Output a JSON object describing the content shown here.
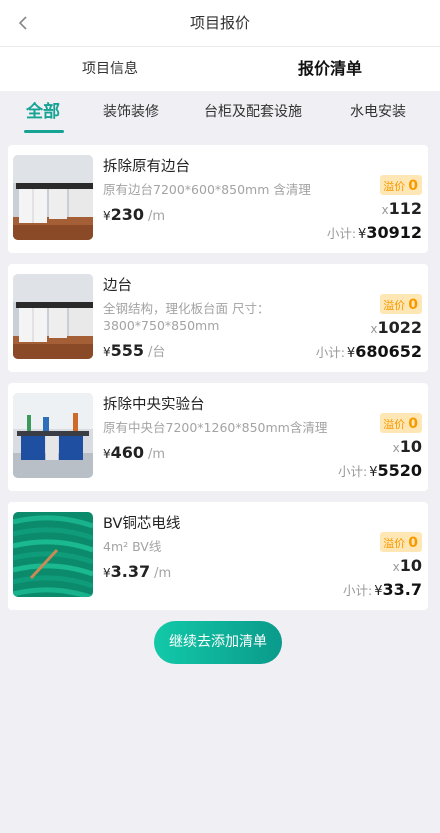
{
  "header": {
    "title": "项目报价"
  },
  "top_tabs": [
    {
      "label": "项目信息"
    },
    {
      "label": "报价清单"
    }
  ],
  "categories": [
    {
      "label": "全部"
    },
    {
      "label": "装饰装修"
    },
    {
      "label": "台柜及配套设施"
    },
    {
      "label": "水电安装"
    }
  ],
  "items": [
    {
      "name": "拆除原有边台",
      "desc": "原有边台7200*600*850mm 含清理",
      "currency": "¥",
      "price": "230",
      "unit": "/m",
      "premium_label": "溢价",
      "premium_value": "0",
      "qty_prefix": "x",
      "qty": "112",
      "subtotal_label": "小计:",
      "subtotal": "30912",
      "image": "lab-bench-photo"
    },
    {
      "name": "边台",
      "desc": "全钢结构，理化板台面 尺寸：3800*750*850mm",
      "currency": "¥",
      "price": "555",
      "unit": "/台",
      "premium_label": "溢价",
      "premium_value": "0",
      "qty_prefix": "x",
      "qty": "1022",
      "subtotal_label": "小计:",
      "subtotal": "680652",
      "image": "lab-bench-photo"
    },
    {
      "name": "拆除中央实验台",
      "desc": "原有中央台7200*1260*850mm含清理",
      "currency": "¥",
      "price": "460",
      "unit": "/m",
      "premium_label": "溢价",
      "premium_value": "0",
      "qty_prefix": "x",
      "qty": "10",
      "subtotal_label": "小计:",
      "subtotal": "5520",
      "image": "central-lab-table-photo"
    },
    {
      "name": "BV铜芯电线",
      "desc": "4m² BV线",
      "currency": "¥",
      "price": "3.37",
      "unit": "/m",
      "premium_label": "溢价",
      "premium_value": "0",
      "qty_prefix": "x",
      "qty": "10",
      "subtotal_label": "小计:",
      "subtotal": "33.7",
      "image": "green-copper-wire-photo"
    }
  ],
  "cta": {
    "label": "继续去添加清单"
  },
  "colors": {
    "accent": "#16a394",
    "premium_bg": "#ffe7b5",
    "premium_text": "#f79a00",
    "background": "#f0eff4"
  }
}
